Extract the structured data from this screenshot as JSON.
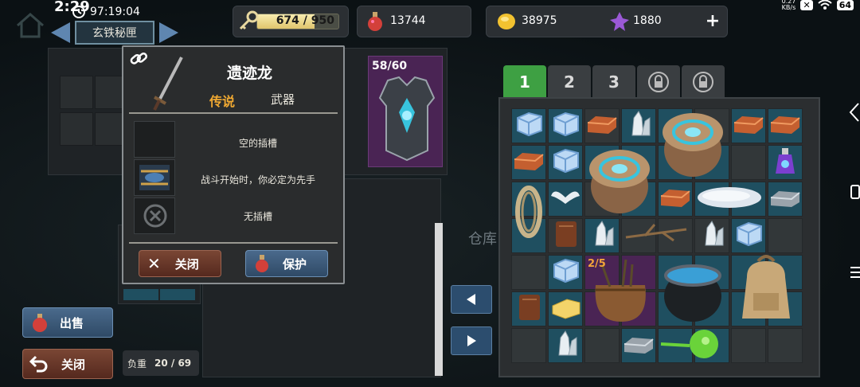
{
  "status_bar": {
    "time": "2:29",
    "net_speed": "0.27\nKB/s",
    "battery": "64"
  },
  "header": {
    "timer": "97:19:04",
    "location": "玄铁秘匣"
  },
  "resources": {
    "stamina_text": "674 / 950",
    "stamina_fraction": 0.709,
    "potions": "13744",
    "gold": "38975",
    "gems": "1880"
  },
  "tooltip": {
    "name": "遗迹龙",
    "rarity": "传说",
    "type": "武器",
    "slot_empty": "空的插槽",
    "effect": "战斗开始时，你必定为先手",
    "no_slot": "无插槽",
    "close_label": "关闭",
    "protect_label": "保护"
  },
  "armor": {
    "count": "58/60"
  },
  "left_buttons": {
    "sell_label": "出售",
    "close_label": "关闭"
  },
  "weight": {
    "label": "负重",
    "value": "20 / 69"
  },
  "inventory": {
    "tabs": [
      "1",
      "2",
      "3"
    ],
    "bag_count": "2/5",
    "storage_label": "仓库"
  },
  "colors": {
    "accent_green": "#3ea043",
    "rarity_gold": "#f0a932",
    "teal_cell": "#1f4f60",
    "purple_cell": "#4a2454"
  }
}
